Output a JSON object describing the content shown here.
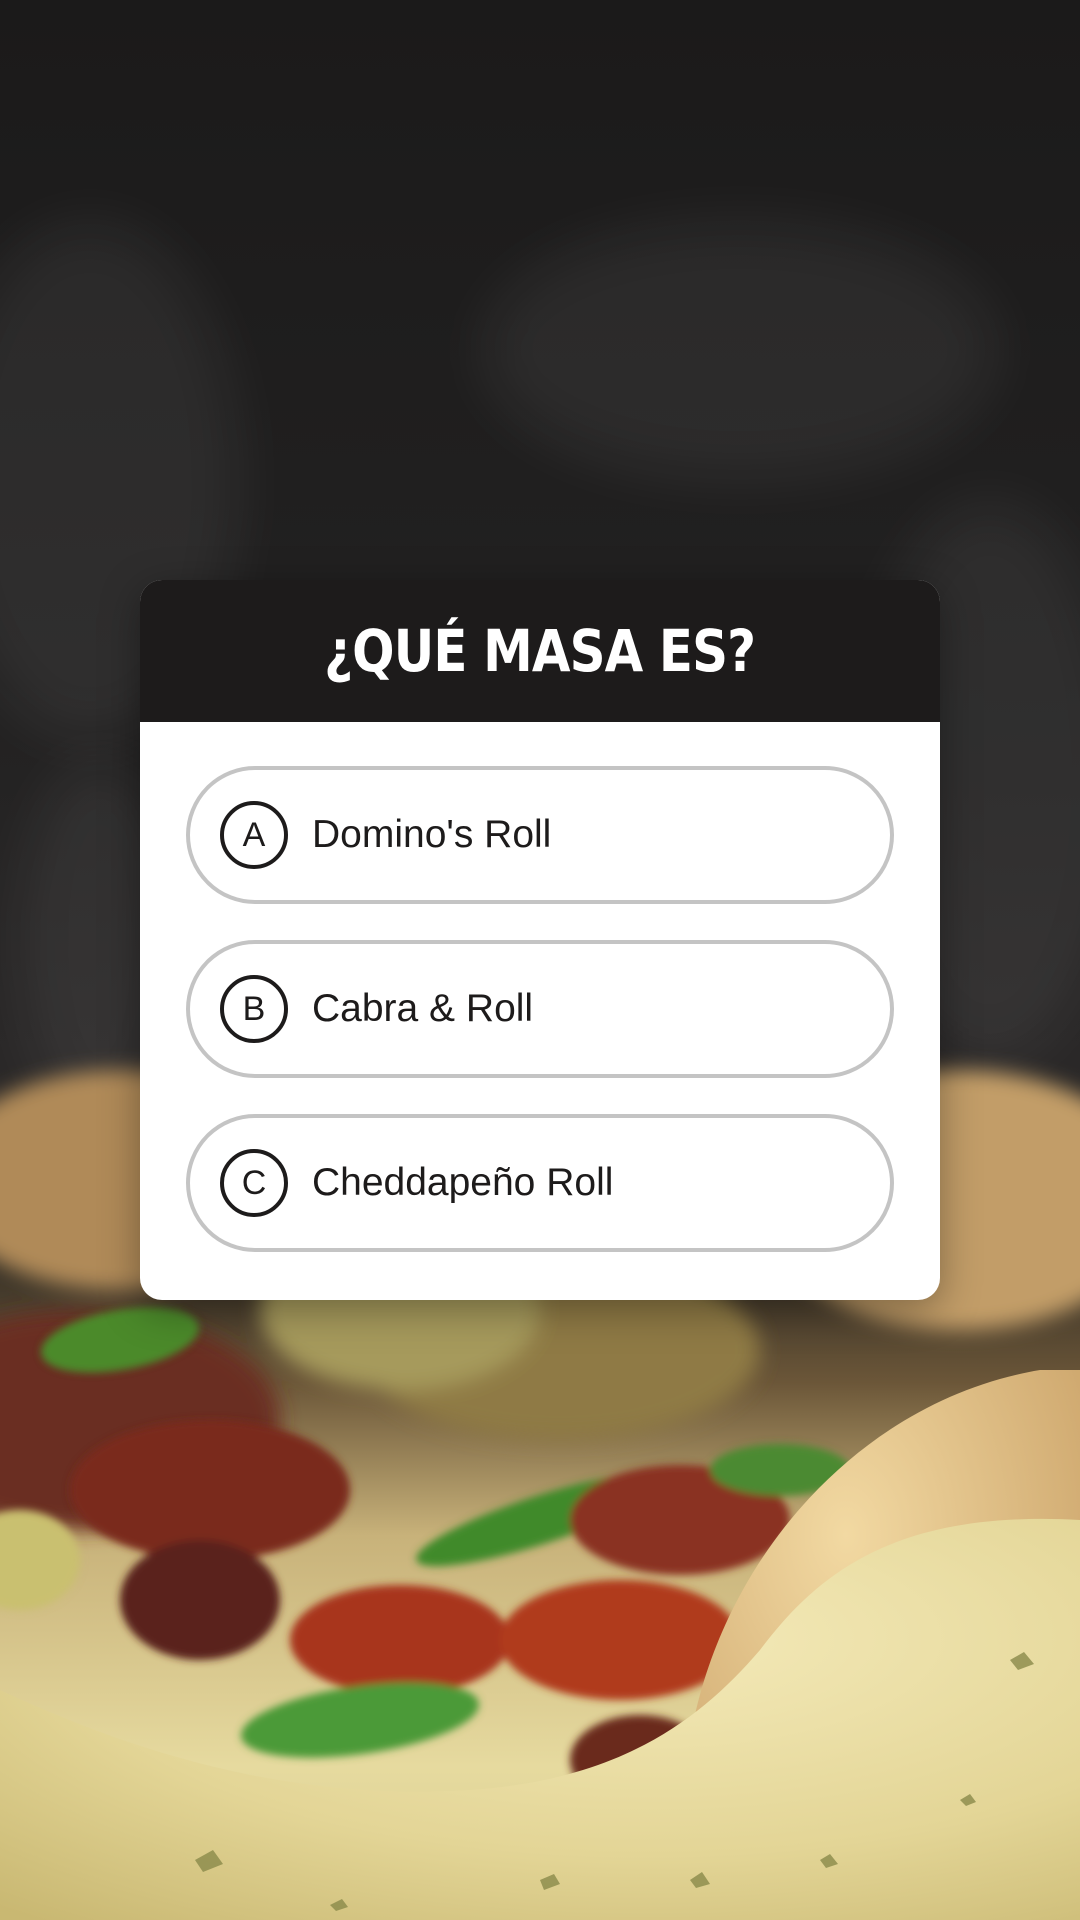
{
  "quiz": {
    "title": "¿QUÉ MASA ES?",
    "options": [
      {
        "letter": "A",
        "label": "Domino's Roll"
      },
      {
        "letter": "B",
        "label": "Cabra & Roll"
      },
      {
        "letter": "C",
        "label": "Cheddapeño Roll"
      }
    ]
  },
  "colors": {
    "background_dark": "#1d1c1c",
    "card_header": "#1d1b1b",
    "card_body": "#ffffff",
    "option_border": "#c4c4c4"
  }
}
